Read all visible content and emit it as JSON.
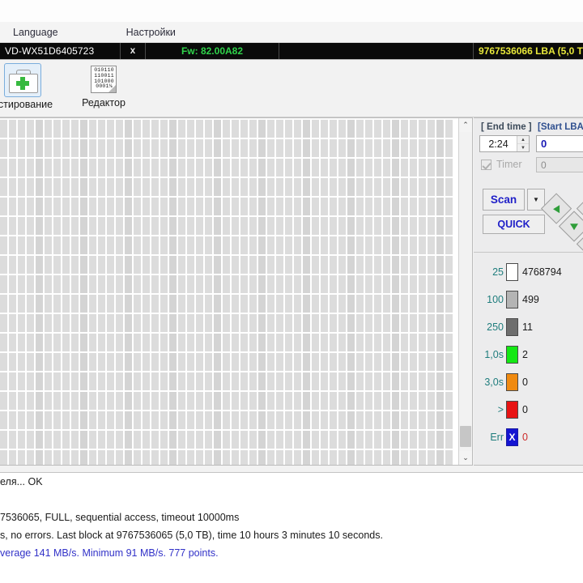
{
  "menu": {
    "items": [
      {
        "label": "Language"
      },
      {
        "label": "Настройки"
      }
    ]
  },
  "drive_bar": {
    "model": "VD-WX51D6405723",
    "close_label": "x",
    "firmware": "Fw: 82.00A82",
    "capacity": "9767536066 LBA (5,0 T"
  },
  "toolbar": {
    "buttons": [
      {
        "label": "естирование",
        "icon": "first-aid-kit-icon"
      },
      {
        "label": "Редактор",
        "icon": "binary-document-icon"
      }
    ],
    "doc_bits": [
      "010110",
      "110011",
      "101000",
      "0001⅛"
    ]
  },
  "controls": {
    "end_time_label": "[ End time ]",
    "end_time_value": "2:24",
    "start_lba_label": "[Start LBA",
    "start_lba_value": "0",
    "timer_label": "Timer",
    "timer_value": "0",
    "scan_label": "Scan",
    "scan_dropdown_glyph": "▼",
    "quick_label": "QUICK"
  },
  "legend": {
    "rows": [
      {
        "name": "25",
        "color": "#ffffff",
        "count": "4768794"
      },
      {
        "name": "100",
        "color": "#b4b4b4",
        "count": "499"
      },
      {
        "name": "250",
        "color": "#6e6e6e",
        "count": "11"
      },
      {
        "name": "1,0s",
        "color": "#14e814",
        "count": "2"
      },
      {
        "name": "3,0s",
        "color": "#f08a10",
        "count": "0"
      },
      {
        "name": ">",
        "color": "#e81414",
        "count": "0"
      },
      {
        "name": "Err",
        "color": "#1414d2",
        "count": "0",
        "glyph": "X"
      }
    ]
  },
  "log": {
    "lines": [
      {
        "text": "еля... OK",
        "blue": false
      },
      {
        "text": "",
        "blue": false
      },
      {
        "text": "7536065, FULL, sequential access, timeout 10000ms",
        "blue": false
      },
      {
        "text": "s, no errors. Last block at 9767536065 (5,0 TB), time 10 hours 3 minutes 10 seconds.",
        "blue": false
      },
      {
        "text": "verage 141 MB/s. Minimum 91 MB/s. 777 points.",
        "blue": true
      }
    ]
  },
  "scrollbar": {
    "up_glyph": "⌃",
    "down_glyph": "⌄"
  }
}
